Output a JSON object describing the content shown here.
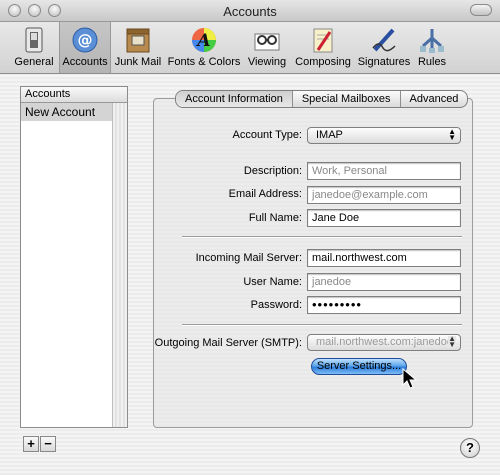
{
  "window": {
    "title": "Accounts"
  },
  "toolbar": {
    "items": [
      {
        "label": "General",
        "icon": "switch-icon"
      },
      {
        "label": "Accounts",
        "icon": "at-icon"
      },
      {
        "label": "Junk Mail",
        "icon": "junk-mail-icon"
      },
      {
        "label": "Fonts & Colors",
        "icon": "fonts-colors-icon"
      },
      {
        "label": "Viewing",
        "icon": "viewing-icon"
      },
      {
        "label": "Composing",
        "icon": "composing-icon"
      },
      {
        "label": "Signatures",
        "icon": "signatures-icon"
      },
      {
        "label": "Rules",
        "icon": "rules-icon"
      }
    ],
    "selected": "Accounts"
  },
  "accounts_list": {
    "header": "Accounts",
    "items": [
      "New Account"
    ],
    "add_label": "+",
    "remove_label": "−"
  },
  "tabs": [
    "Account Information",
    "Special Mailboxes",
    "Advanced"
  ],
  "form": {
    "account_type": {
      "label": "Account Type:",
      "value": "IMAP"
    },
    "description": {
      "label": "Description:",
      "placeholder": "Work, Personal"
    },
    "email": {
      "label": "Email Address:",
      "placeholder": "janedoe@example.com"
    },
    "full_name": {
      "label": "Full Name:",
      "value": "Jane Doe"
    },
    "incoming_server": {
      "label": "Incoming Mail Server:",
      "value": "mail.northwest.com"
    },
    "user_name": {
      "label": "User Name:",
      "placeholder": "janedoe"
    },
    "password": {
      "label": "Password:",
      "value": "•••••••••"
    },
    "smtp": {
      "label": "Outgoing Mail Server (SMTP):",
      "value": "mail.northwest.com:janedoe"
    },
    "server_settings_label": "Server Settings..."
  },
  "help_label": "?",
  "colors": {
    "aqua_blue": "#2f7ddb",
    "selection_gray": "#d4d4d4"
  }
}
